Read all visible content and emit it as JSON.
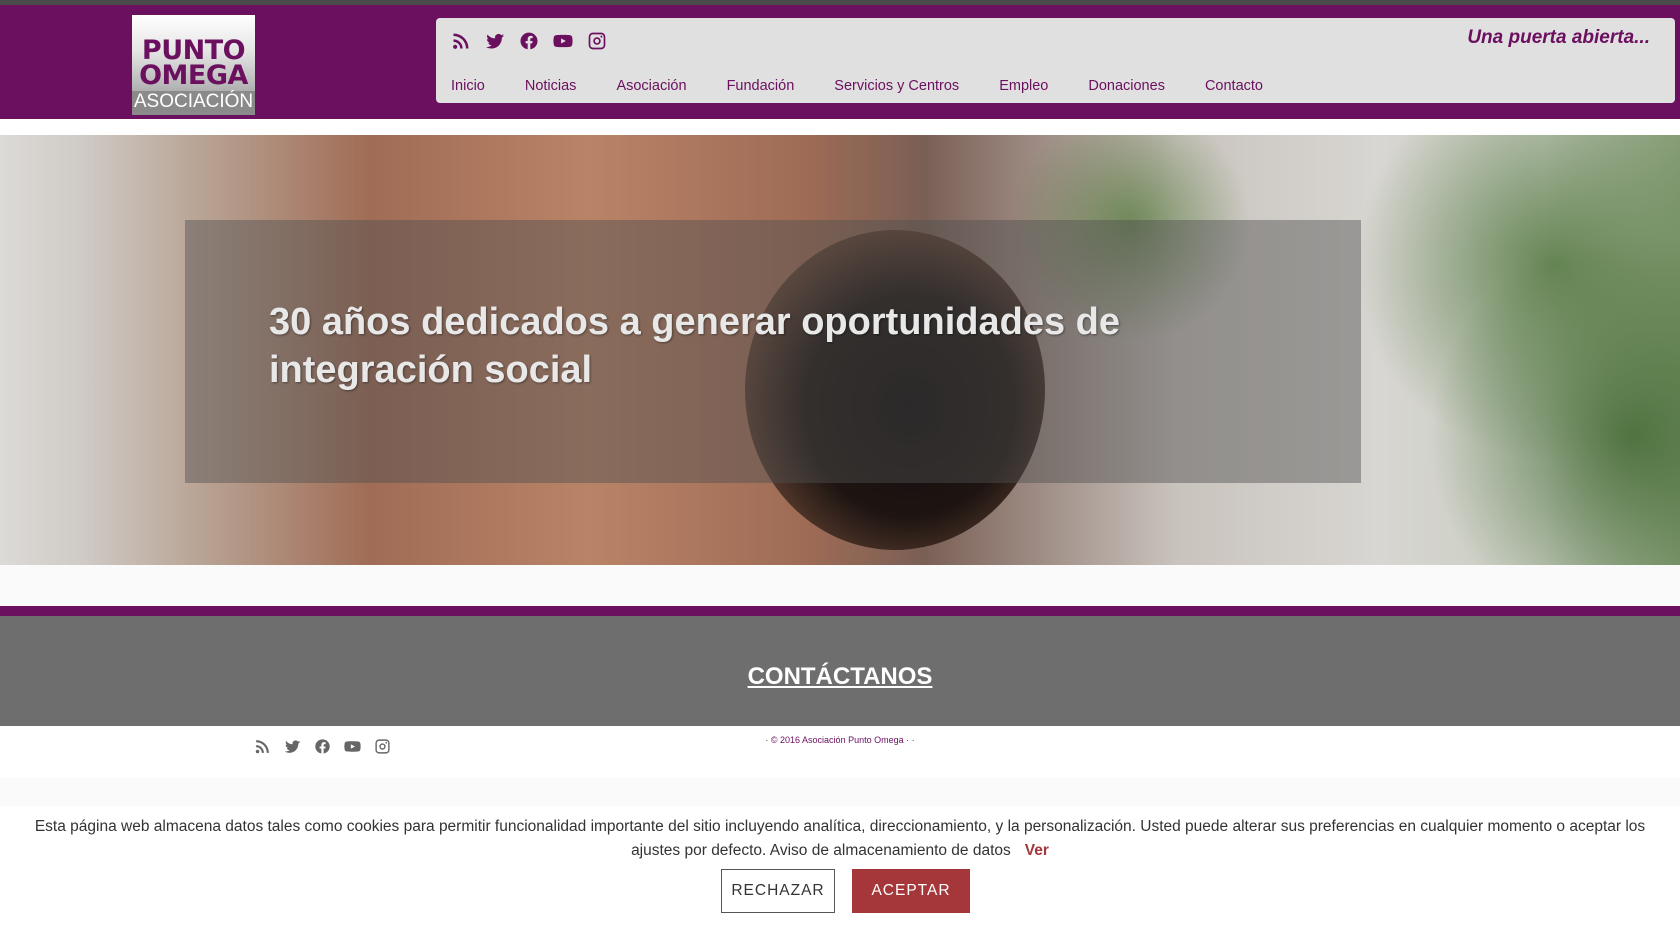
{
  "header": {
    "logo": {
      "line1": "PUNTO",
      "line2": "OMEGA",
      "line3": "ASOCIACIÓN"
    },
    "tagline": "Una puerta abierta...",
    "social_icons": [
      "rss-icon",
      "twitter-icon",
      "facebook-icon",
      "youtube-icon",
      "instagram-icon"
    ],
    "nav": [
      "Inicio",
      "Noticias",
      "Asociación",
      "Fundación",
      "Servicios y Centros",
      "Empleo",
      "Donaciones",
      "Contacto"
    ]
  },
  "hero": {
    "title": "30 años dedicados a generar oportunidades de integración social"
  },
  "contact": {
    "title": "CONTÁCTANOS"
  },
  "footer": {
    "copyright": "· © 2016 Asociación Punto Omega ·   ·"
  },
  "cookie": {
    "text": "Esta página web almacena datos tales como cookies para permitir funcionalidad importante del sitio incluyendo analítica, direccionamiento, y la personalización. Usted puede alterar sus preferencias en cualquier momento o aceptar los ajustes por defecto. Aviso de almacenamiento de datos",
    "link": "Ver",
    "reject": "RECHAZAR",
    "accept": "ACEPTAR"
  },
  "colors": {
    "brand_purple": "#6b0f5f",
    "accept_red": "#a5373a",
    "contact_band": "#6e6e6e"
  }
}
